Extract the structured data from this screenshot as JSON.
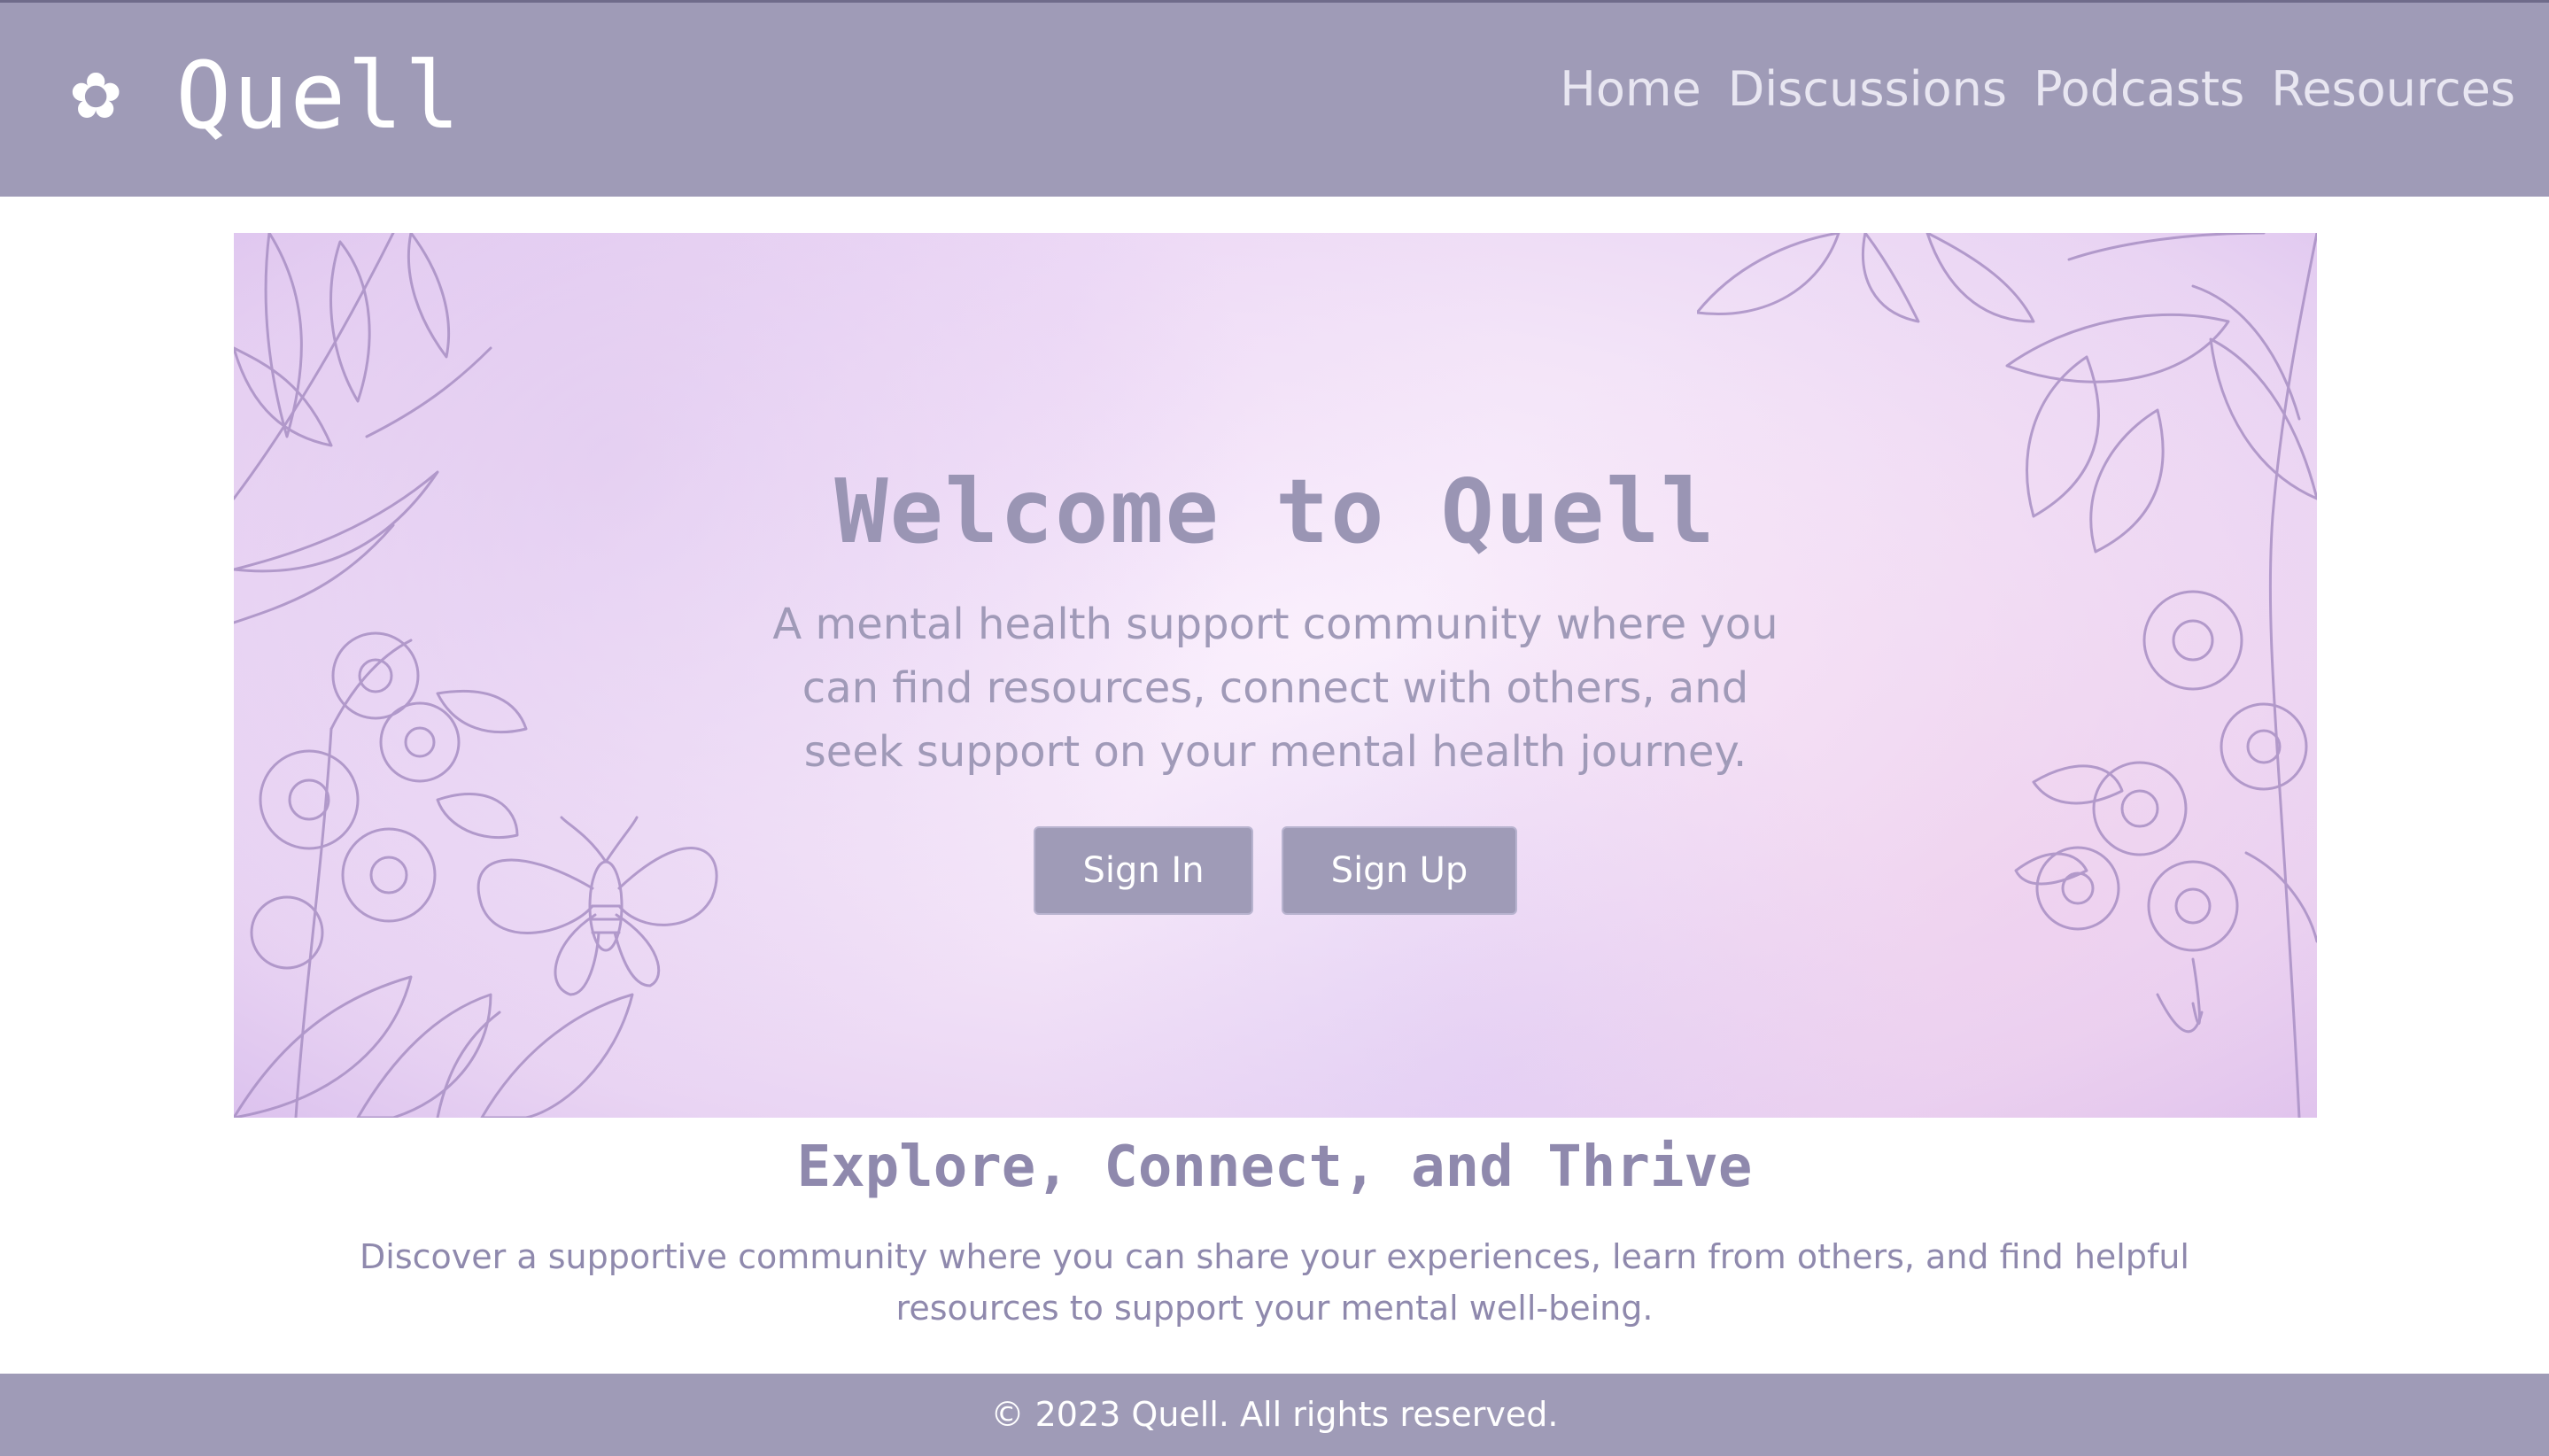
{
  "header": {
    "logo_icon": "✿",
    "logo_text": "Quell",
    "nav": [
      {
        "label": "Home"
      },
      {
        "label": "Discussions"
      },
      {
        "label": "Podcasts"
      },
      {
        "label": "Resources"
      }
    ]
  },
  "hero": {
    "title": "Welcome to Quell",
    "subtitle": "A mental health support community where you can find resources, connect with others, and seek support on your mental health journey.",
    "signin_label": "Sign In",
    "signup_label": "Sign Up"
  },
  "section": {
    "title": "Explore, Connect, and Thrive",
    "text": "Discover a supportive community where you can share your experiences, learn from others, and find helpful resources to support your mental well-being."
  },
  "footer": {
    "text": "© 2023 Quell. All rights reserved."
  },
  "colors": {
    "header_bg": "#9f9bb7",
    "accent_text": "#8f89ad",
    "hero_title": "#9a95b4",
    "floral_line": "#a88fc4"
  },
  "icons": {
    "logo": "flower-icon"
  }
}
